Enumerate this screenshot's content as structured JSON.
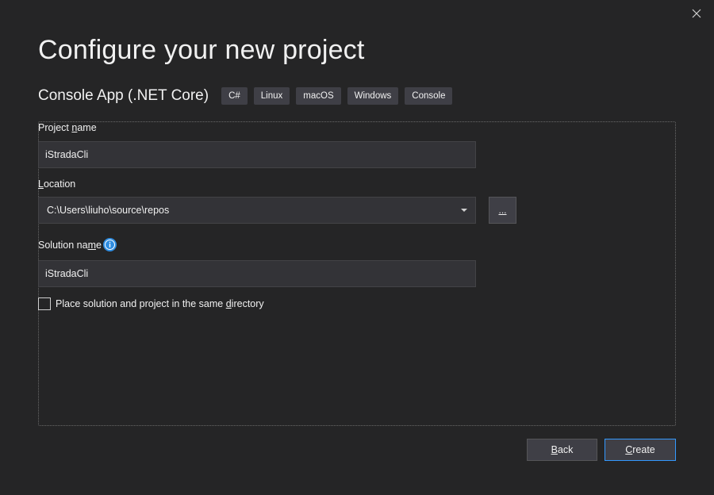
{
  "dialog": {
    "title": "Configure your new project",
    "close_glyph": "close-icon"
  },
  "template": {
    "name": "Console App (.NET Core)",
    "tags": [
      "C#",
      "Linux",
      "macOS",
      "Windows",
      "Console"
    ]
  },
  "form": {
    "project_name": {
      "label_pre": "Project ",
      "label_access": "n",
      "label_post": "ame",
      "value": "iStradaCli"
    },
    "location": {
      "label_access": "L",
      "label_post": "ocation",
      "value": "C:\\Users\\liuho\\source\\repos",
      "browse_label": "..."
    },
    "solution_name": {
      "label_pre": "Solution na",
      "label_access": "m",
      "label_post": "e",
      "value": "iStradaCli"
    },
    "same_directory": {
      "label_pre": "Place solution and project in the same ",
      "label_access": "d",
      "label_post": "irectory",
      "checked": false
    }
  },
  "footer": {
    "back_access": "B",
    "back_post": "ack",
    "create_access": "C",
    "create_post": "reate"
  },
  "colors": {
    "background": "#252526",
    "input_bg": "#333337",
    "button_bg": "#3f3f46",
    "accent": "#3399ff",
    "info_blue": "#2e8ce0"
  }
}
